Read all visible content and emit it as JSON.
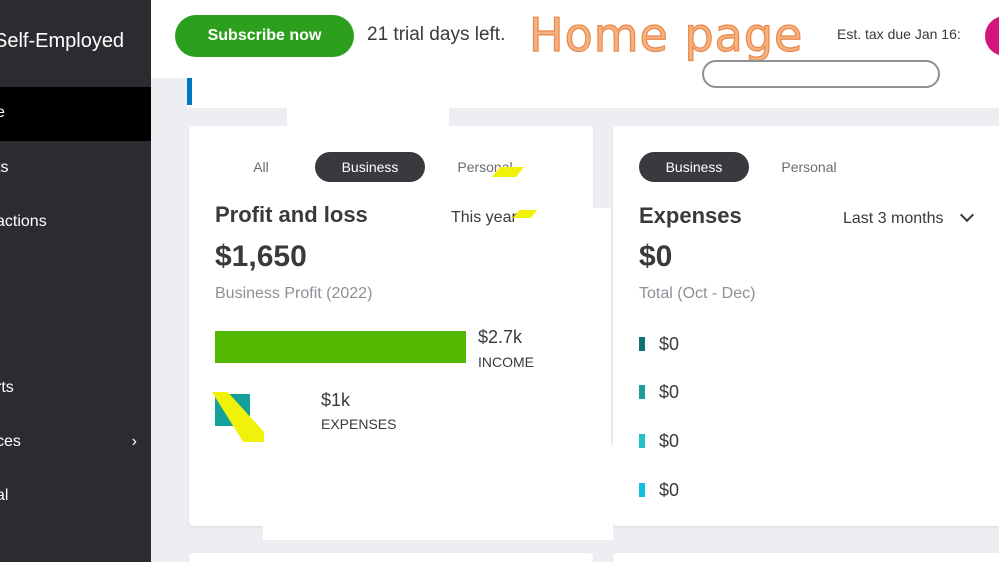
{
  "sidebar": {
    "brand": "Self-Employed",
    "items": [
      {
        "label": "e"
      },
      {
        "label": "ts"
      },
      {
        "label": "actions"
      },
      {
        "label": "rts"
      },
      {
        "label": "ces"
      },
      {
        "label": "al"
      }
    ],
    "chevron": "›"
  },
  "topbar": {
    "subscribe_label": "Subscribe now",
    "trial_text": "21 trial days left.",
    "overlay_title": "Home page",
    "tax_due": "Est. tax due Jan 16:"
  },
  "profit_loss": {
    "tabs": [
      "All",
      "Business",
      "Personal"
    ],
    "active_tab": "Business",
    "title": "Profit and loss",
    "period": "This year",
    "amount": "$1,650",
    "subtitle": "Business Profit (2022)",
    "income": {
      "value": "$2.7k",
      "label": "INCOME",
      "amount": 2.7
    },
    "expenses": {
      "value": "$1k",
      "label": "EXPENSES",
      "amount": 1.0
    }
  },
  "expenses_card": {
    "tabs": [
      "Business",
      "Personal"
    ],
    "active_tab": "Business",
    "title": "Expenses",
    "period": "Last 3 months",
    "amount": "$0",
    "subtitle": "Total (Oct - Dec)",
    "legend": [
      {
        "value": "$0",
        "color": "#0d7377"
      },
      {
        "value": "$0",
        "color": "#1a9e9e"
      },
      {
        "value": "$0",
        "color": "#22c1c3"
      },
      {
        "value": "$0",
        "color": "#10c2e0"
      }
    ]
  },
  "colors": {
    "income_bar": "#53b700",
    "expense_bar": "#15a19a",
    "subscribe": "#2ca01c",
    "sidebar": "#2b2c2f"
  }
}
